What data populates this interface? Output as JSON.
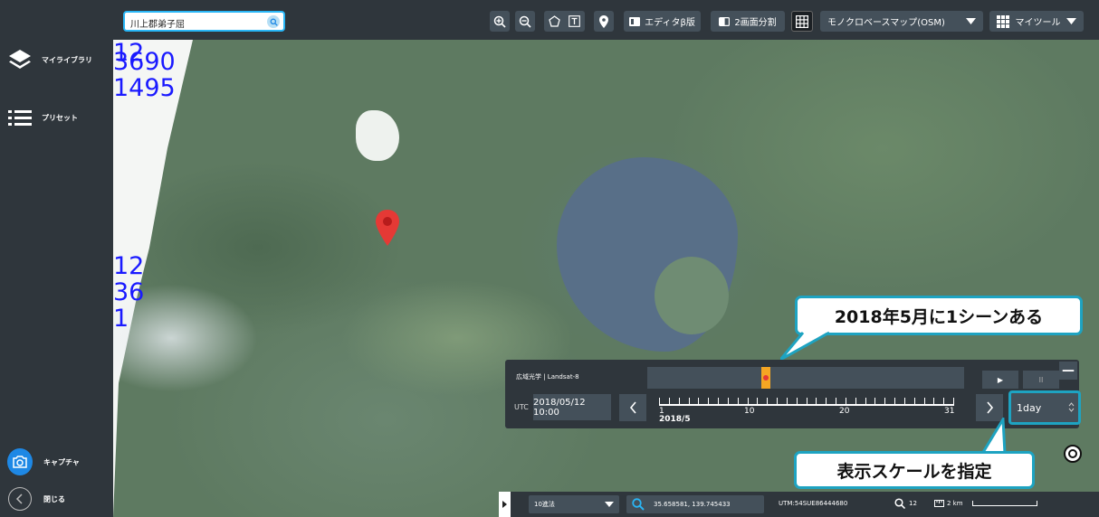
{
  "sidebar": {
    "library_label": "マイライブラリ",
    "preset_label": "プリセット",
    "capture_label": "キャプチャ",
    "close_label": "閉じる"
  },
  "topbar": {
    "search_value": "川上郡弟子屈",
    "editor_label": "エディタβ版",
    "split_label": "2画面分割",
    "basemap_label": "モノクロベースマップ(OSM)",
    "mytool_label": "マイツール"
  },
  "map": {
    "labels": [
      "12",
      "3690",
      "1495",
      "12",
      "36",
      "1"
    ]
  },
  "timeline": {
    "title": "広域光学 | Landsat-8",
    "utc_label": "UTC",
    "datetime": "2018/05/12 10:00",
    "tick_labels": [
      "1",
      "10",
      "20",
      "31"
    ],
    "month_label": "2018/5",
    "play_label": "▶",
    "pause_label": "II",
    "scale_value": "1day",
    "minimize_label": "—"
  },
  "callouts": {
    "top": "2018年5月に1シーンある",
    "bottom": "表示スケールを指定"
  },
  "bottombar": {
    "method_label": "10進法",
    "coords": "35.658581, 139.745433",
    "utm": "UTM:54SUE86444680",
    "zoom": "12",
    "scale": "2 km"
  },
  "colors": {
    "accent": "#1ea3c1",
    "search_border": "#29b6f6",
    "marker": "#f5a623",
    "pin": "#e53935",
    "panel_bg": "#2f363c",
    "button_bg": "#44505a"
  }
}
